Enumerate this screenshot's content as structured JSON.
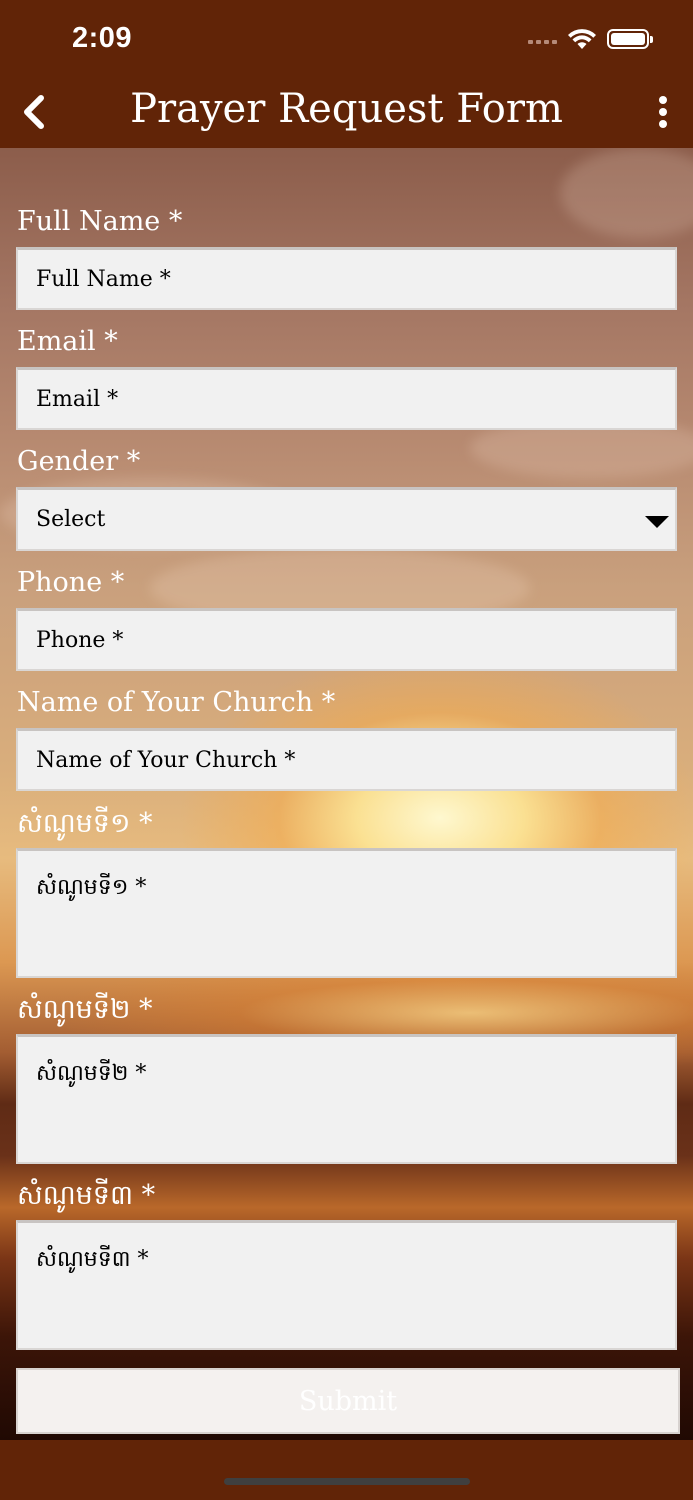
{
  "status_bar": {
    "time": "2:09"
  },
  "nav": {
    "title": "Prayer Request Form"
  },
  "form": {
    "full_name": {
      "label": "Full Name *",
      "placeholder": "Full Name *"
    },
    "email": {
      "label": "Email *",
      "placeholder": "Email *"
    },
    "gender": {
      "label": "Gender *",
      "selected": "Select"
    },
    "phone": {
      "label": "Phone *",
      "placeholder": "Phone *"
    },
    "church": {
      "label": "Name of Your Church *",
      "placeholder": "Name of Your Church *"
    },
    "request1": {
      "label": "សំណូមទី១ *",
      "placeholder": "សំណូមទី១ *"
    },
    "request2": {
      "label": "សំណូមទី២ *",
      "placeholder": "សំណូមទី២ *"
    },
    "request3": {
      "label": "សំណូមទី៣ *",
      "placeholder": "សំណូមទី៣ *"
    },
    "submit_label": "Submit"
  },
  "icons": {
    "back": "chevron-left-icon",
    "more": "more-vertical-icon",
    "dropdown": "caret-down-icon",
    "wifi": "wifi-icon",
    "battery": "battery-icon",
    "signal": "signal-icon"
  },
  "colors": {
    "header_bg": "#612407",
    "input_bg": "#f1f1f1",
    "label_text": "#ffffff"
  }
}
